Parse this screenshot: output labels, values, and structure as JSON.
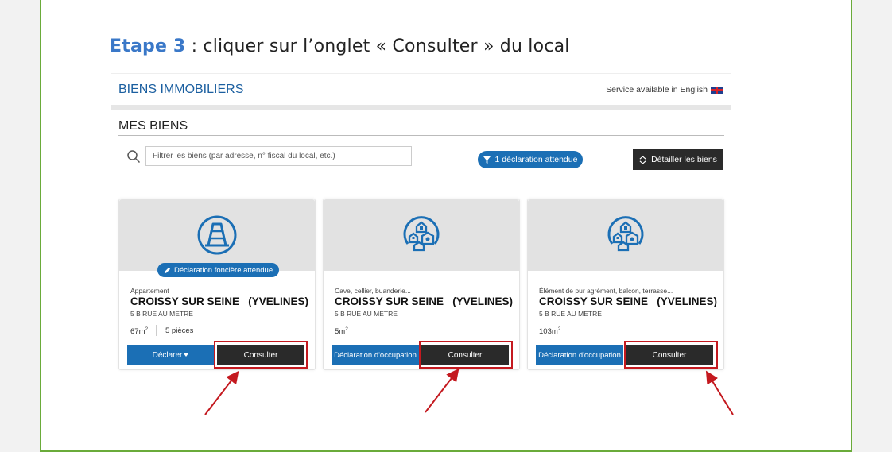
{
  "step": {
    "label": "Etape 3",
    "text": " : cliquer sur l’onglet « Consulter » du local"
  },
  "header": {
    "title": "BIENS IMMOBILIERS",
    "english_link": "Service available in English",
    "flag_icon": "uk-flag-icon"
  },
  "section": {
    "title": "MES BIENS"
  },
  "search": {
    "placeholder": "Filtrer les biens (par adresse, n° fiscal du local, etc.)",
    "icon": "search-icon"
  },
  "filter_button": {
    "label": "1 déclaration attendue",
    "icon": "filter-icon"
  },
  "detail_button": {
    "label": "Détailler les biens",
    "icon": "expand-icon"
  },
  "cards": [
    {
      "icon": "construction-cone-icon",
      "badge": "Déclaration foncière attendue",
      "badge_icon": "pencil-icon",
      "type": "Appartement",
      "city": "CROISSY SUR SEINE   (YVELINES)",
      "address": "5 B RUE AU METRE",
      "size": "67m",
      "size_sup": "2",
      "rooms": "5 pièces",
      "action_label": "Déclarer",
      "consult_label": "Consulter"
    },
    {
      "icon": "property-group-icon",
      "type": "Cave, cellier, buanderie...",
      "city": "CROISSY SUR SEINE   (YVELINES)",
      "address": "5 B RUE AU METRE",
      "size": "5m",
      "size_sup": "2",
      "action_label": "Déclaration d'occupation",
      "consult_label": "Consulter"
    },
    {
      "icon": "property-group-icon",
      "type": "Élément de pur agrément, balcon, terrasse...",
      "city": "CROISSY SUR SEINE   (YVELINES)",
      "address": "5 B RUE AU METRE",
      "size": "103m",
      "size_sup": "2",
      "action_label": "Déclaration d'occupation",
      "consult_label": "Consulter"
    }
  ],
  "colors": {
    "frame_border": "#6aab3a",
    "accent_blue": "#1b6fb5",
    "step_label": "#3a78c8",
    "highlight_red": "#c4191f",
    "dark_button": "#2a2a2a"
  }
}
